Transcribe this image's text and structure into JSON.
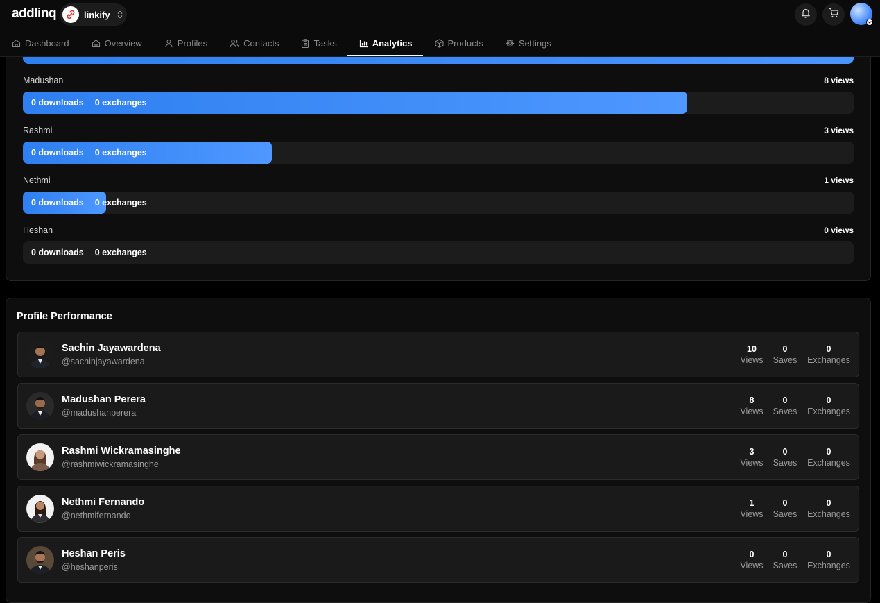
{
  "brand": {
    "logo": "addlinq",
    "workspace": "linkify"
  },
  "nav": {
    "tabs": [
      {
        "label": "Dashboard",
        "icon": "home-icon"
      },
      {
        "label": "Overview",
        "icon": "home-icon"
      },
      {
        "label": "Profiles",
        "icon": "user-icon"
      },
      {
        "label": "Contacts",
        "icon": "users-icon"
      },
      {
        "label": "Tasks",
        "icon": "clipboard-icon"
      },
      {
        "label": "Analytics",
        "icon": "bar-chart-icon",
        "active": true
      },
      {
        "label": "Products",
        "icon": "box-icon"
      },
      {
        "label": "Settings",
        "icon": "gear-icon"
      }
    ]
  },
  "views_breakdown": {
    "rows": [
      {
        "name": "Madushan",
        "views": "8 views",
        "downloads": "0 downloads",
        "exchanges": "0 exchanges",
        "fill": 0.8
      },
      {
        "name": "Rashmi",
        "views": "3 views",
        "downloads": "0 downloads",
        "exchanges": "0 exchanges",
        "fill": 0.3
      },
      {
        "name": "Nethmi",
        "views": "1 views",
        "downloads": "0 downloads",
        "exchanges": "0 exchanges",
        "fill": 0.1
      },
      {
        "name": "Heshan",
        "views": "0 views",
        "downloads": "0 downloads",
        "exchanges": "0 exchanges",
        "fill": 0
      }
    ]
  },
  "profile_performance": {
    "title": "Profile Performance",
    "stat_labels": {
      "views": "Views",
      "saves": "Saves",
      "exchanges": "Exchanges"
    },
    "profiles": [
      {
        "name": "Sachin Jayawardena",
        "handle": "@sachinjayawardena",
        "views": "10",
        "saves": "0",
        "exchanges": "0"
      },
      {
        "name": "Madushan Perera",
        "handle": "@madushanperera",
        "views": "8",
        "saves": "0",
        "exchanges": "0"
      },
      {
        "name": "Rashmi Wickramasinghe",
        "handle": "@rashmiwickramasinghe",
        "views": "3",
        "saves": "0",
        "exchanges": "0"
      },
      {
        "name": "Nethmi Fernando",
        "handle": "@nethmifernando",
        "views": "1",
        "saves": "0",
        "exchanges": "0"
      },
      {
        "name": "Heshan Peris",
        "handle": "@heshanperis",
        "views": "0",
        "saves": "0",
        "exchanges": "0"
      }
    ]
  },
  "colors": {
    "accent": "#3b8cff",
    "background": "#000000",
    "card": "#0e0e0e",
    "row": "#1a1a1a"
  }
}
